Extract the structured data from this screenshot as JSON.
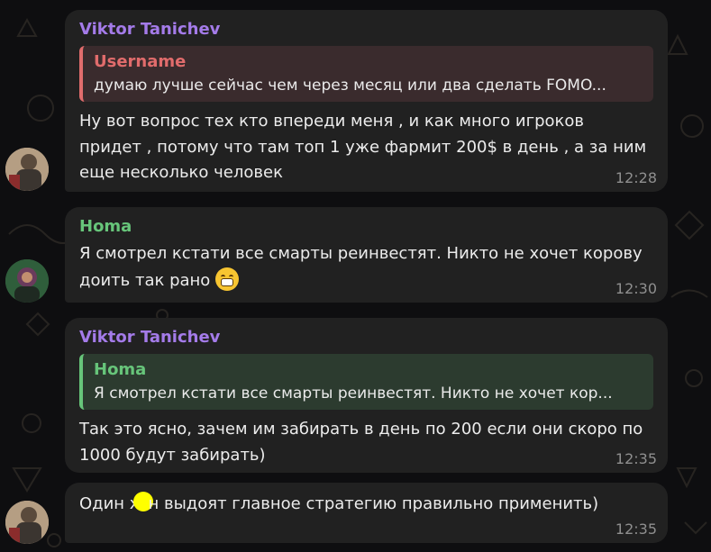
{
  "colors": {
    "viktor": "#a47be9",
    "username_reply": "#e16c6c",
    "homa": "#67c57a",
    "bubble": "#212121",
    "time": "#8f8f8f"
  },
  "messages": [
    {
      "sender": "Viktor Tanichev",
      "reply": {
        "name": "Username",
        "text": "думаю лучше сейчас чем через месяц или два сделать FOMO..."
      },
      "lines": [
        "Ну вот вопрос тех кто впереди меня , и как много игроков",
        "придет , потому что там топ 1 уже фармит 200$ в день , а за ним",
        "еще несколько человек"
      ],
      "time": "12:28"
    },
    {
      "sender": "Homa",
      "lines": [
        "Я смотрел кстати все смарты реинвестят. Никто не хочет корову",
        "доить так рано"
      ],
      "time": "12:30"
    },
    {
      "sender": "Viktor Tanichev",
      "reply": {
        "name": "Homa",
        "text": "Я смотрел кстати все смарты реинвестят. Никто не хочет кор..."
      },
      "lines": [
        "Так это ясно, зачем им забирать в день по 200 если они скоро по",
        "1000 будут забирать)"
      ],
      "time": "12:35"
    },
    {
      "text_before": "Один х",
      "text_after": "н выдоят главное стратегию правильно применить)",
      "time": "12:35"
    }
  ]
}
